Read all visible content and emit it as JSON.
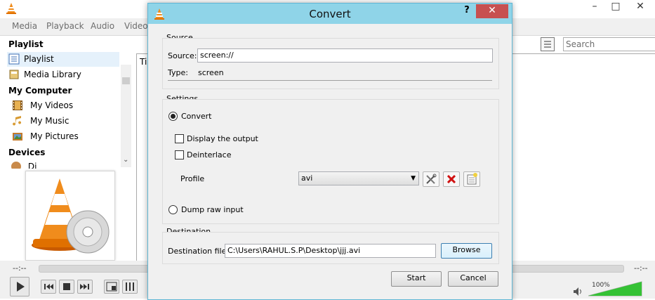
{
  "background": {
    "menu": [
      "Media",
      "Playback",
      "Audio",
      "Video"
    ],
    "window_buttons": [
      "–",
      "□",
      "✕"
    ],
    "search_placeholder": "Search",
    "playlist_col_fragment": "Ti",
    "sidebar": {
      "playlist_header": "Playlist",
      "items_playlist": [
        {
          "label": "Playlist",
          "icon": "playlist-icon"
        },
        {
          "label": "Media Library",
          "icon": "media-library-icon"
        }
      ],
      "computer_header": "My Computer",
      "items_computer": [
        {
          "label": "My Videos",
          "icon": "film-icon"
        },
        {
          "label": "My Music",
          "icon": "music-note-icon"
        },
        {
          "label": "My Pictures",
          "icon": "picture-icon"
        }
      ],
      "devices_header": "Devices",
      "devices_item_fragment": "Di"
    },
    "time_elapsed": "--:--",
    "time_total": "--:--",
    "volume": "100%"
  },
  "dialog": {
    "title": "Convert",
    "help": "?",
    "close": "✕",
    "source": {
      "group_title": "Source",
      "source_label": "Source:",
      "source_value": "screen://",
      "type_label": "Type:",
      "type_value": "screen"
    },
    "settings": {
      "group_title": "Settings",
      "convert_label": "Convert",
      "display_output_label": "Display the output",
      "deinterlace_label": "Deinterlace",
      "profile_label": "Profile",
      "profile_value": "avi",
      "dump_raw_label": "Dump raw input"
    },
    "destination": {
      "group_title": "Destination",
      "file_label": "Destination file:",
      "file_value": "C:\\Users\\RAHUL.S.P\\Desktop\\jjj.avi",
      "browse_label": "Browse"
    },
    "start_label": "Start",
    "cancel_label": "Cancel"
  },
  "colors": {
    "dialog_title_bar": "#8fd4e8",
    "close_button": "#c75050",
    "vlc_orange": "#f08c1c",
    "volume_green": "#35c235"
  }
}
